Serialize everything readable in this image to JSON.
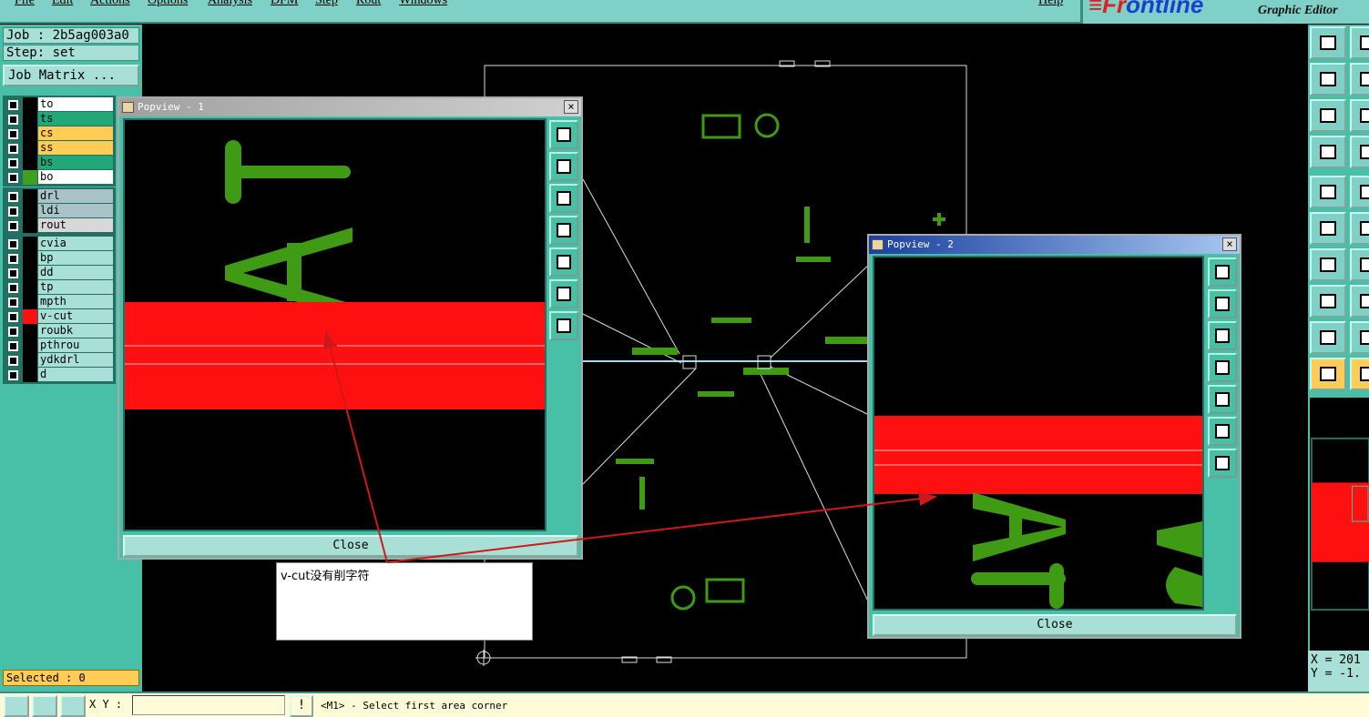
{
  "menubar": {
    "items": [
      "File",
      "Edit",
      "Actions",
      "Options",
      "Analysis",
      "DFM",
      "Step",
      "Rout",
      "Windows",
      "Help"
    ]
  },
  "brand": {
    "logo_a": "≡Fr",
    "logo_b": "ontline",
    "subtitle": "Graphic Editor"
  },
  "job": {
    "job_label": "Job : 2b5ag003a0",
    "step_label": "Step: set",
    "matrix_button": "Job Matrix ..."
  },
  "layers": {
    "group1": [
      {
        "name": "to",
        "color": "#ffffff",
        "swatch": "#000000"
      },
      {
        "name": "ts",
        "color": "#20a878",
        "swatch": "#000000"
      },
      {
        "name": "cs",
        "color": "#ffcc55",
        "swatch": "#000000"
      },
      {
        "name": "ss",
        "color": "#ffcc55",
        "swatch": "#000000"
      },
      {
        "name": "bs",
        "color": "#20a878",
        "swatch": "#000000"
      },
      {
        "name": "bo",
        "color": "#ffffff",
        "swatch": "#3fa020"
      }
    ],
    "group2": [
      {
        "name": "drl",
        "color": "#a9c4c8",
        "swatch": "#000000"
      },
      {
        "name": "ldi",
        "color": "#a9c4c8",
        "swatch": "#000000"
      },
      {
        "name": "rout",
        "color": "#d8d8d8",
        "swatch": "#000000"
      }
    ],
    "group3": [
      {
        "name": "cvia",
        "color": "#a8e0d8",
        "swatch": "#000000"
      },
      {
        "name": "bp",
        "color": "#a8e0d8",
        "swatch": "#000000"
      },
      {
        "name": "dd",
        "color": "#a8e0d8",
        "swatch": "#000000"
      },
      {
        "name": "tp",
        "color": "#a8e0d8",
        "swatch": "#000000"
      },
      {
        "name": "mpth",
        "color": "#a8e0d8",
        "swatch": "#000000"
      },
      {
        "name": "v-cut",
        "color": "#a8e0d8",
        "swatch": "#ff1010"
      },
      {
        "name": "roubk",
        "color": "#a8e0d8",
        "swatch": "#000000"
      },
      {
        "name": "pthrou",
        "color": "#a8e0d8",
        "swatch": "#000000"
      },
      {
        "name": "ydkdrl",
        "color": "#a8e0d8",
        "swatch": "#000000"
      },
      {
        "name": "d",
        "color": "#a8e0d8",
        "swatch": "#000000"
      }
    ]
  },
  "selected": {
    "label": "Selected : 0"
  },
  "popview1": {
    "title": "Popview - 1",
    "close_label": "Close",
    "glyphs": "AT"
  },
  "popview2": {
    "title": "Popview - 2",
    "close_label": "Close",
    "glyphs": "AT"
  },
  "note": {
    "text": "v-cut没有削字符"
  },
  "coords": {
    "x": "X = 201",
    "y": "Y = -1."
  },
  "statusbar": {
    "xy_label": "X Y :",
    "xy_value": "",
    "message": "<M1> - Select first area corner",
    "alert": "!"
  },
  "colors": {
    "panel": "#48c0a8",
    "menu": "#7fd1c7",
    "vcut": "#ff1010",
    "silk": "#3f9a14"
  }
}
